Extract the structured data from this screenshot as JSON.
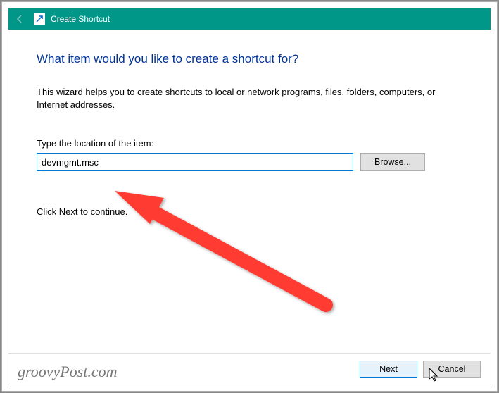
{
  "titlebar": {
    "title": "Create Shortcut"
  },
  "content": {
    "heading": "What item would you like to create a shortcut for?",
    "description": "This wizard helps you to create shortcuts to local or network programs, files, folders, computers, or Internet addresses.",
    "field_label": "Type the location of the item:",
    "location_value": "devmgmt.msc",
    "browse_label": "Browse...",
    "continue_text": "Click Next to continue."
  },
  "footer": {
    "next_label": "Next",
    "cancel_label": "Cancel"
  },
  "watermark": "groovyPost.com"
}
